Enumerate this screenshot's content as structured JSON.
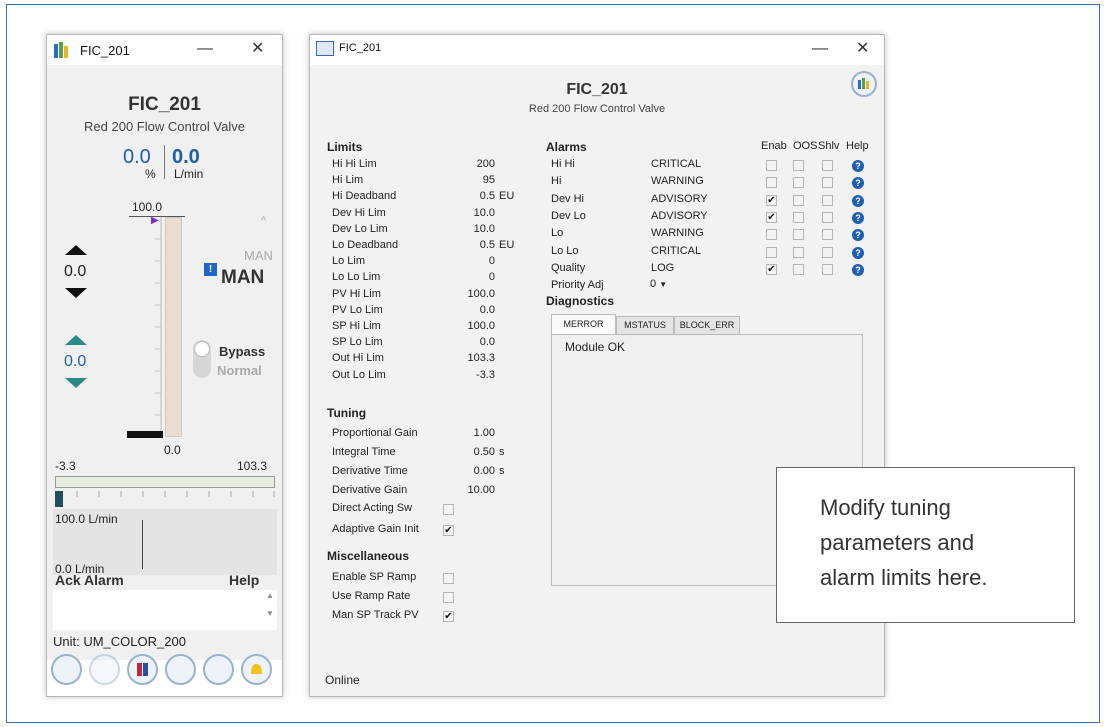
{
  "left": {
    "title": "FIC_201",
    "heading": "FIC_201",
    "description": "Red 200 Flow Control Valve",
    "pv_value": "0.0",
    "pv_unit": "%",
    "flow_value": "0.0",
    "flow_unit": "L/min",
    "bar_top": "100.0",
    "bar_bottom": "0.0",
    "sp_value": "0.0",
    "out_value": "0.0",
    "mode_target": "MAN",
    "mode_actual": "MAN",
    "bypass_label": "Bypass",
    "normal_label": "Normal",
    "range_low": "-3.3",
    "range_high": "103.3",
    "trend_high": "100.0 L/min",
    "trend_low": "0.0 L/min",
    "ack_alarm": "Ack Alarm",
    "help": "Help",
    "unit_label": "Unit: UM_COLOR_200",
    "colors": {
      "pv": "#1f5fa8",
      "bar": "#e8ddd0",
      "trend_band": "#e7efe1"
    }
  },
  "right": {
    "title": "FIC_201",
    "heading": "FIC_201",
    "description": "Red 200 Flow Control Valve",
    "limits_header": "Limits",
    "limits": [
      {
        "label": "Hi Hi Lim",
        "value": "200",
        "unit": ""
      },
      {
        "label": "Hi Lim",
        "value": "95",
        "unit": ""
      },
      {
        "label": "Hi Deadband",
        "value": "0.5",
        "unit": "EU"
      },
      {
        "label": "Dev Hi Lim",
        "value": "10.0",
        "unit": ""
      },
      {
        "label": "Dev Lo Lim",
        "value": "10.0",
        "unit": ""
      },
      {
        "label": "Lo Deadband",
        "value": "0.5",
        "unit": "EU"
      },
      {
        "label": "Lo Lim",
        "value": "0",
        "unit": ""
      },
      {
        "label": "Lo Lo Lim",
        "value": "0",
        "unit": ""
      },
      {
        "label": "PV Hi Lim",
        "value": "100.0",
        "unit": ""
      },
      {
        "label": "PV Lo Lim",
        "value": "0.0",
        "unit": ""
      },
      {
        "label": "SP Hi Lim",
        "value": "100.0",
        "unit": ""
      },
      {
        "label": "SP Lo Lim",
        "value": "0.0",
        "unit": ""
      },
      {
        "label": "Out Hi Lim",
        "value": "103.3",
        "unit": ""
      },
      {
        "label": "Out Lo Lim",
        "value": "-3.3",
        "unit": ""
      }
    ],
    "tuning_header": "Tuning",
    "tuning": [
      {
        "label": "Proportional Gain",
        "value": "1.00",
        "unit": ""
      },
      {
        "label": "Integral Time",
        "value": "0.50",
        "unit": "s"
      },
      {
        "label": "Derivative Time",
        "value": "0.00",
        "unit": "s"
      },
      {
        "label": "Derivative Gain",
        "value": "10.00",
        "unit": ""
      }
    ],
    "tuning_checks": [
      {
        "label": "Direct Acting Sw",
        "checked": false
      },
      {
        "label": "Adaptive Gain Init",
        "checked": true
      }
    ],
    "misc_header": "Miscellaneous",
    "misc": [
      {
        "label": "Enable SP Ramp",
        "checked": false
      },
      {
        "label": "Use Ramp Rate",
        "checked": false
      },
      {
        "label": "Man SP Track PV",
        "checked": true
      }
    ],
    "alarms_header": "Alarms",
    "alarm_cols": [
      "Enab",
      "OOS",
      "Shlv",
      "Help"
    ],
    "alarms": [
      {
        "label": "Hi Hi",
        "priority": "CRITICAL",
        "enab": false
      },
      {
        "label": "Hi",
        "priority": "WARNING",
        "enab": false
      },
      {
        "label": "Dev Hi",
        "priority": "ADVISORY",
        "enab": true
      },
      {
        "label": "Dev Lo",
        "priority": "ADVISORY",
        "enab": true
      },
      {
        "label": "Lo",
        "priority": "WARNING",
        "enab": false
      },
      {
        "label": "Lo Lo",
        "priority": "CRITICAL",
        "enab": false
      },
      {
        "label": "Quality",
        "priority": "LOG",
        "enab": true
      }
    ],
    "priority_adj_label": "Priority Adj",
    "priority_adj_value": "0",
    "diagnostics_header": "Diagnostics",
    "tabs": [
      "MERROR",
      "MSTATUS",
      "BLOCK_ERR"
    ],
    "diag_text": "Module OK",
    "status": "Online"
  },
  "callout": {
    "line1": "Modify tuning",
    "line2": "parameters and",
    "line3": "alarm limits here."
  }
}
